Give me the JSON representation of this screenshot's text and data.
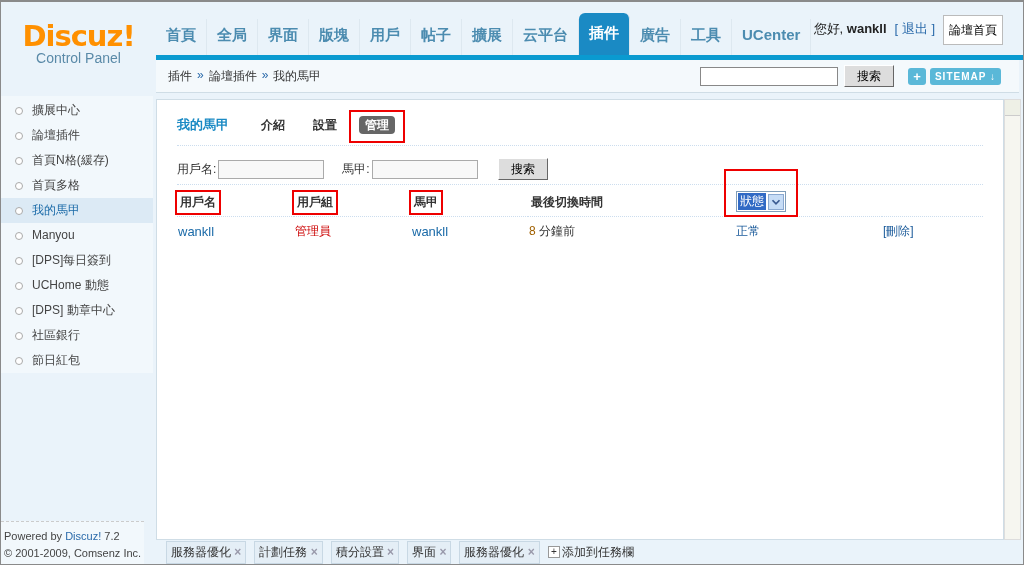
{
  "logo": {
    "name": "Discuz!",
    "subtitle": "Control Panel"
  },
  "nav": [
    {
      "label": "首頁",
      "selected": false
    },
    {
      "label": "全局",
      "selected": false
    },
    {
      "label": "界面",
      "selected": false
    },
    {
      "label": "版塊",
      "selected": false
    },
    {
      "label": "用戶",
      "selected": false
    },
    {
      "label": "帖子",
      "selected": false
    },
    {
      "label": "擴展",
      "selected": false
    },
    {
      "label": "云平台",
      "selected": false
    },
    {
      "label": "插件",
      "selected": true
    },
    {
      "label": "廣告",
      "selected": false
    },
    {
      "label": "工具",
      "selected": false
    },
    {
      "label": "UCenter",
      "selected": false
    }
  ],
  "user": {
    "greeting": "您好,",
    "name": "wankll",
    "logout": "[ 退出 ]",
    "home_button": "論壇首頁"
  },
  "breadcrumb": [
    {
      "label": "插件"
    },
    {
      "separator": "»",
      "label": "論壇插件"
    },
    {
      "separator": "»",
      "label": "我的馬甲"
    }
  ],
  "top_search": {
    "button": "搜索"
  },
  "sitemap": {
    "add": "+",
    "label": "SITEMAP ↓"
  },
  "sidebar": {
    "items": [
      {
        "label": "擴展中心",
        "selected": false
      },
      {
        "label": "論壇插件",
        "selected": false
      },
      {
        "label": "首頁N格(緩存)",
        "selected": false
      },
      {
        "label": "首頁多格",
        "selected": false
      },
      {
        "label": "我的馬甲",
        "selected": true
      },
      {
        "label": "Manyou",
        "selected": false
      },
      {
        "label": "[DPS]每日簽到",
        "selected": false
      },
      {
        "label": "UCHome 動態",
        "selected": false
      },
      {
        "label": "[DPS] 動章中心",
        "selected": false
      },
      {
        "label": "社區銀行",
        "selected": false
      },
      {
        "label": "節日紅包",
        "selected": false
      }
    ],
    "footer": [
      "Powered by **Discuz!** 7.2",
      "© 2001-2009, Comsenz Inc."
    ]
  },
  "page": {
    "title": "我的馬甲",
    "tabs": [
      {
        "label": "介紹",
        "selected": false,
        "annotated": false
      },
      {
        "label": "設置",
        "selected": false,
        "annotated": false
      },
      {
        "label": "管理",
        "selected": true,
        "annotated": true
      }
    ]
  },
  "filter": {
    "fields": [
      {
        "label": "用戶名:"
      },
      {
        "label": "馬甲:"
      }
    ],
    "button": "搜索"
  },
  "table": {
    "columns": [
      {
        "label": "用戶名",
        "kind": "text",
        "annotated": true
      },
      {
        "label": "用戶組",
        "kind": "text",
        "annotated": true
      },
      {
        "label": "馬甲",
        "kind": "text",
        "annotated": true
      },
      {
        "label": "最後切換時間",
        "kind": "text",
        "annotated": false
      },
      {
        "label": "狀態",
        "kind": "select",
        "annotated": true
      }
    ],
    "rows": [
      {
        "user": "wankll",
        "group": "管理員",
        "alias": "wankll",
        "time_num": "8",
        "time_unit": "分鐘前",
        "status": "正常",
        "action": "[刪除]"
      }
    ]
  },
  "taskbar": {
    "items": [
      {
        "label": "服務器優化",
        "close": "×"
      },
      {
        "label": "計劃任務",
        "close": "×"
      },
      {
        "label": "積分設置",
        "close": "×"
      },
      {
        "label": "界面",
        "close": "×"
      },
      {
        "label": "服務器優化",
        "close": "×"
      }
    ],
    "add": {
      "icon": "+",
      "label": "添加到任務欄"
    }
  }
}
